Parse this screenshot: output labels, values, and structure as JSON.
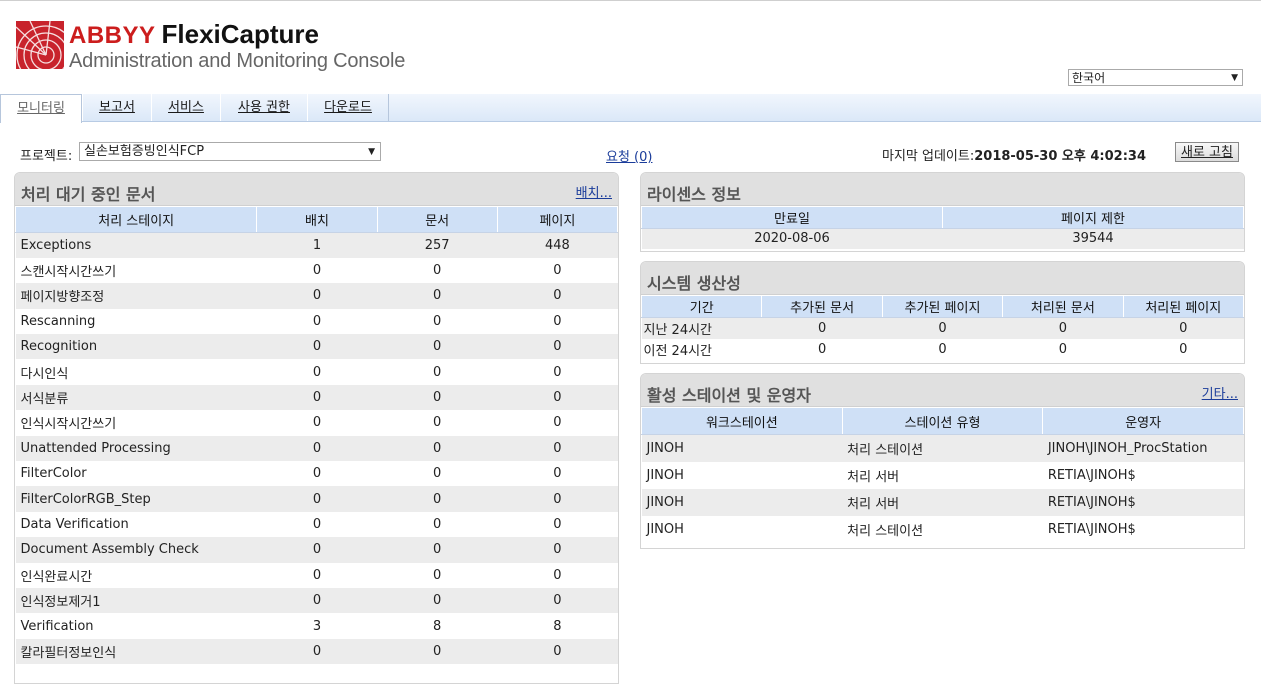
{
  "brand": {
    "abbyy": "ABBYY",
    "product": "FlexiCapture",
    "subtitle": "Administration and Monitoring Console"
  },
  "language": {
    "selected": "한국어"
  },
  "tabs": [
    {
      "label": "모니터링",
      "active": true
    },
    {
      "label": "보고서"
    },
    {
      "label": "서비스"
    },
    {
      "label": "사용 권한"
    },
    {
      "label": "다운로드"
    }
  ],
  "toolbar": {
    "project_label": "프로젝트:",
    "project_value": "실손보험증빙인식FCP",
    "requests_link": "요청 (0)",
    "updated_label": "마지막 업데이트:",
    "updated_value": "2018-05-30 오후 4:02:34",
    "refresh_label": "새로 고침"
  },
  "queue": {
    "title": "처리 대기 중인 문서",
    "link": "배치...",
    "columns": [
      "처리 스테이지",
      "배치",
      "문서",
      "페이지"
    ],
    "rows": [
      [
        "Exceptions",
        "1",
        "257",
        "448"
      ],
      [
        "스캔시작시간쓰기",
        "0",
        "0",
        "0"
      ],
      [
        "페이지방향조정",
        "0",
        "0",
        "0"
      ],
      [
        "Rescanning",
        "0",
        "0",
        "0"
      ],
      [
        "Recognition",
        "0",
        "0",
        "0"
      ],
      [
        "다시인식",
        "0",
        "0",
        "0"
      ],
      [
        "서식분류",
        "0",
        "0",
        "0"
      ],
      [
        "인식시작시간쓰기",
        "0",
        "0",
        "0"
      ],
      [
        "Unattended Processing",
        "0",
        "0",
        "0"
      ],
      [
        "FilterColor",
        "0",
        "0",
        "0"
      ],
      [
        "FilterColorRGB_Step",
        "0",
        "0",
        "0"
      ],
      [
        "Data Verification",
        "0",
        "0",
        "0"
      ],
      [
        "Document Assembly Check",
        "0",
        "0",
        "0"
      ],
      [
        "인식완료시간",
        "0",
        "0",
        "0"
      ],
      [
        "인식정보제거1",
        "0",
        "0",
        "0"
      ],
      [
        "Verification",
        "3",
        "8",
        "8"
      ],
      [
        "칼라필터정보인식",
        "0",
        "0",
        "0"
      ]
    ]
  },
  "license": {
    "title": "라이센스 정보",
    "columns": [
      "만료일",
      "페이지 제한"
    ],
    "row": [
      "2020-08-06",
      "39544"
    ]
  },
  "productivity": {
    "title": "시스템 생산성",
    "columns": [
      "기간",
      "추가된 문서",
      "추가된 페이지",
      "처리된 문서",
      "처리된 페이지"
    ],
    "rows": [
      [
        "지난 24시간",
        "0",
        "0",
        "0",
        "0"
      ],
      [
        "이전 24시간",
        "0",
        "0",
        "0",
        "0"
      ]
    ]
  },
  "stations": {
    "title": "활성 스테이션 및 운영자",
    "link": "기타...",
    "columns": [
      "워크스테이션",
      "스테이션 유형",
      "운영자"
    ],
    "rows": [
      [
        "JINOH",
        "처리 스테이션",
        "JINOH\\JINOH_ProcStation"
      ],
      [
        "JINOH",
        "처리 서버",
        "RETIA\\JINOH$"
      ],
      [
        "JINOH",
        "처리 서버",
        "RETIA\\JINOH$"
      ],
      [
        "JINOH",
        "처리 스테이션",
        "RETIA\\JINOH$"
      ]
    ]
  },
  "colors": {
    "brand_red": "#cc1d1d",
    "header_blue": "#cfe0f6",
    "link": "#1a3c9a"
  }
}
